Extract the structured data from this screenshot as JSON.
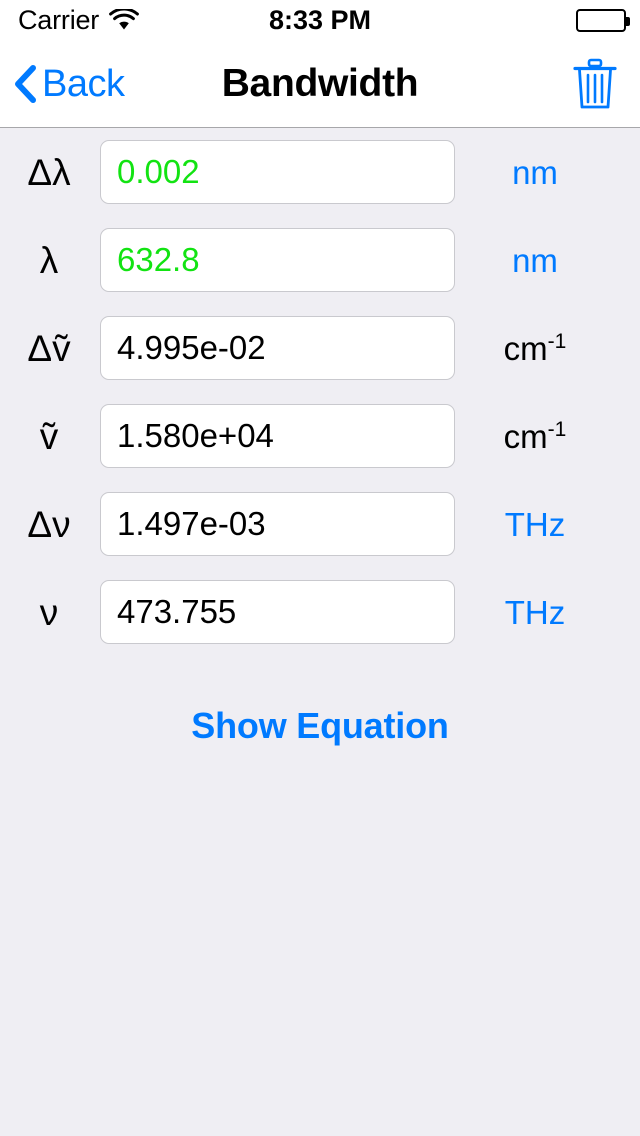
{
  "status_bar": {
    "carrier": "Carrier",
    "wifi_icon": "wifi-icon",
    "time": "8:33 PM",
    "battery_icon": "battery-full-icon"
  },
  "nav_bar": {
    "back_label": "Back",
    "back_icon": "chevron-left-icon",
    "title": "Bandwidth",
    "trash_icon": "trash-icon"
  },
  "rows": [
    {
      "label": "Δλ",
      "value": "0.002",
      "unit": "nm",
      "unit_sup": "",
      "unit_color": "blue",
      "entered": true
    },
    {
      "label": "λ",
      "value": "632.8",
      "unit": "nm",
      "unit_sup": "",
      "unit_color": "blue",
      "entered": true
    },
    {
      "label": "Δṽ",
      "value": "4.995e-02",
      "unit": "cm",
      "unit_sup": "-1",
      "unit_color": "black",
      "entered": false
    },
    {
      "label": "ṽ",
      "value": "1.580e+04",
      "unit": "cm",
      "unit_sup": "-1",
      "unit_color": "black",
      "entered": false
    },
    {
      "label": "Δν",
      "value": "1.497e-03",
      "unit": "THz",
      "unit_sup": "",
      "unit_color": "blue",
      "entered": false
    },
    {
      "label": "ν",
      "value": "473.755",
      "unit": "THz",
      "unit_sup": "",
      "unit_color": "blue",
      "entered": false
    }
  ],
  "actions": {
    "show_equation_label": "Show Equation"
  },
  "colors": {
    "accent_blue": "#007AFF",
    "entered_green": "#12E312",
    "body_background": "#EFEEF3",
    "bar_background": "#FFFFFF",
    "field_border": "#C9C9CE"
  }
}
